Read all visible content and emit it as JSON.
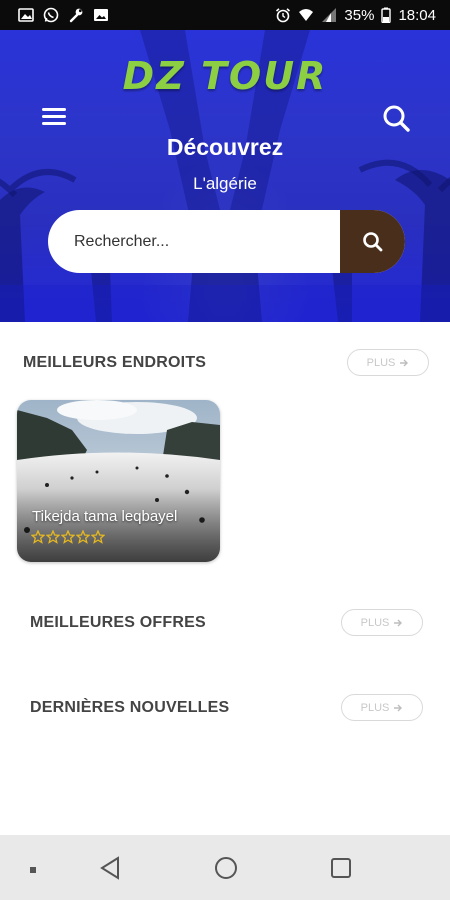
{
  "status_bar": {
    "battery": "35%",
    "time": "18:04",
    "icons": [
      "image-icon",
      "whatsapp-icon",
      "wrench-icon",
      "gallery-icon",
      "alarm-icon",
      "wifi-icon",
      "signal-icon",
      "battery-icon"
    ]
  },
  "header": {
    "logo": "DZ TOUR",
    "title": "Découvrez",
    "subtitle": "L'algérie",
    "search": {
      "placeholder": "Rechercher..."
    }
  },
  "sections": {
    "best_places": {
      "title": "MEILLEURS ENDROITS",
      "plus_label": "PLUS",
      "places": [
        {
          "name": "Tikejda tama leqbayel",
          "rating": 5
        }
      ]
    },
    "best_offers": {
      "title": "MEILLEURES OFFRES",
      "plus_label": "PLUS"
    },
    "latest_news": {
      "title": "DERNIÈRES NOUVELLES",
      "plus_label": "PLUS"
    }
  },
  "colors": {
    "hero": "#2a33d8",
    "logo": "#8ccf43",
    "search_button": "#4a2e1c",
    "star": "#e6b820"
  }
}
